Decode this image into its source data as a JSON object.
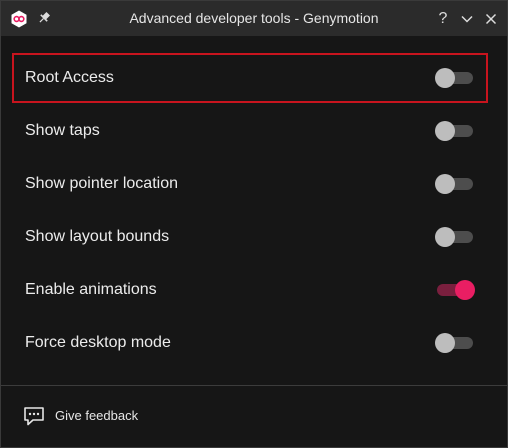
{
  "window": {
    "title": "Advanced developer tools - Genymotion",
    "app_icon": "genymotion-logo-icon",
    "pin_icon": "pin-icon",
    "controls": {
      "help_label": "?",
      "collapse_icon": "chevron-down-icon",
      "close_icon": "close-icon"
    }
  },
  "settings": [
    {
      "label": "Root Access",
      "enabled": false,
      "highlighted": true
    },
    {
      "label": "Show taps",
      "enabled": false
    },
    {
      "label": "Show pointer location",
      "enabled": false
    },
    {
      "label": "Show layout bounds",
      "enabled": false
    },
    {
      "label": "Enable animations",
      "enabled": true
    },
    {
      "label": "Force desktop mode",
      "enabled": false
    }
  ],
  "footer": {
    "feedback_label": "Give feedback",
    "feedback_icon": "chat-bubble-icon"
  },
  "colors": {
    "accent": "#e91e63",
    "accent_track": "#7a1f3e",
    "highlight_border": "#c8141e",
    "background": "#161616",
    "titlebar": "#2b2b2b"
  }
}
